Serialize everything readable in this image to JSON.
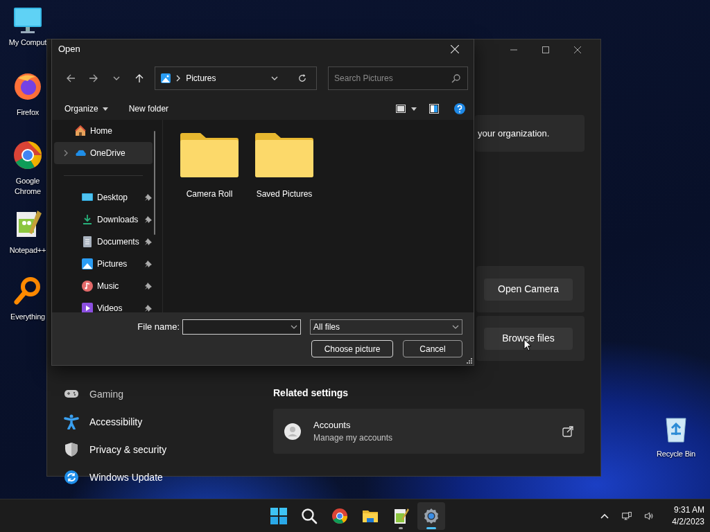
{
  "desktop_icons": [
    {
      "kind": "computer",
      "label": "My Comput"
    },
    {
      "kind": "firefox",
      "label": "Firefox"
    },
    {
      "kind": "chrome",
      "label": "Google Chrome"
    },
    {
      "kind": "notepad",
      "label": "Notepad++"
    },
    {
      "kind": "everything",
      "label": "Everything"
    },
    {
      "kind": "recycle",
      "label": "Recycle Bin"
    }
  ],
  "settings_window": {
    "org_text": "your organization.",
    "camera_button": "Open Camera",
    "browse_button": "Browse files",
    "nav": [
      {
        "kind": "gaming",
        "label": "Gaming"
      },
      {
        "kind": "accessibility",
        "label": "Accessibility"
      },
      {
        "kind": "privacy",
        "label": "Privacy & security"
      },
      {
        "kind": "update",
        "label": "Windows Update"
      }
    ],
    "related_heading": "Related settings",
    "related": [
      {
        "title": "Accounts",
        "subtitle": "Manage my accounts"
      }
    ]
  },
  "open_dialog": {
    "title": "Open",
    "path": "Pictures",
    "search_placeholder": "Search Pictures",
    "organize": "Organize",
    "new_folder": "New folder",
    "nav_pane": [
      {
        "kind": "home",
        "label": "Home",
        "selected": false,
        "expandable": false,
        "pinned": false
      },
      {
        "kind": "onedrive",
        "label": "OneDrive",
        "selected": true,
        "expandable": true,
        "pinned": false
      },
      {
        "kind": "desktop",
        "label": "Desktop",
        "selected": false,
        "expandable": false,
        "pinned": true
      },
      {
        "kind": "downloads",
        "label": "Downloads",
        "selected": false,
        "expandable": false,
        "pinned": true
      },
      {
        "kind": "documents",
        "label": "Documents",
        "selected": false,
        "expandable": false,
        "pinned": true
      },
      {
        "kind": "pictures",
        "label": "Pictures",
        "selected": false,
        "expandable": false,
        "pinned": true
      },
      {
        "kind": "music",
        "label": "Music",
        "selected": false,
        "expandable": false,
        "pinned": true
      },
      {
        "kind": "videos",
        "label": "Videos",
        "selected": false,
        "expandable": false,
        "pinned": true
      }
    ],
    "folders": [
      "Camera Roll",
      "Saved Pictures"
    ],
    "file_name_label": "File name:",
    "file_type": "All files",
    "choose_button": "Choose picture",
    "cancel_button": "Cancel"
  },
  "taskbar": {
    "apps": [
      {
        "kind": "start",
        "selected": false,
        "running": false
      },
      {
        "kind": "search",
        "selected": false,
        "running": false
      },
      {
        "kind": "chrome",
        "selected": false,
        "running": false
      },
      {
        "kind": "explorer",
        "selected": false,
        "running": false
      },
      {
        "kind": "notepad",
        "selected": false,
        "running": true
      },
      {
        "kind": "settings",
        "selected": true,
        "running": true
      }
    ],
    "time": "9:31 AM",
    "date": "4/2/2023"
  }
}
